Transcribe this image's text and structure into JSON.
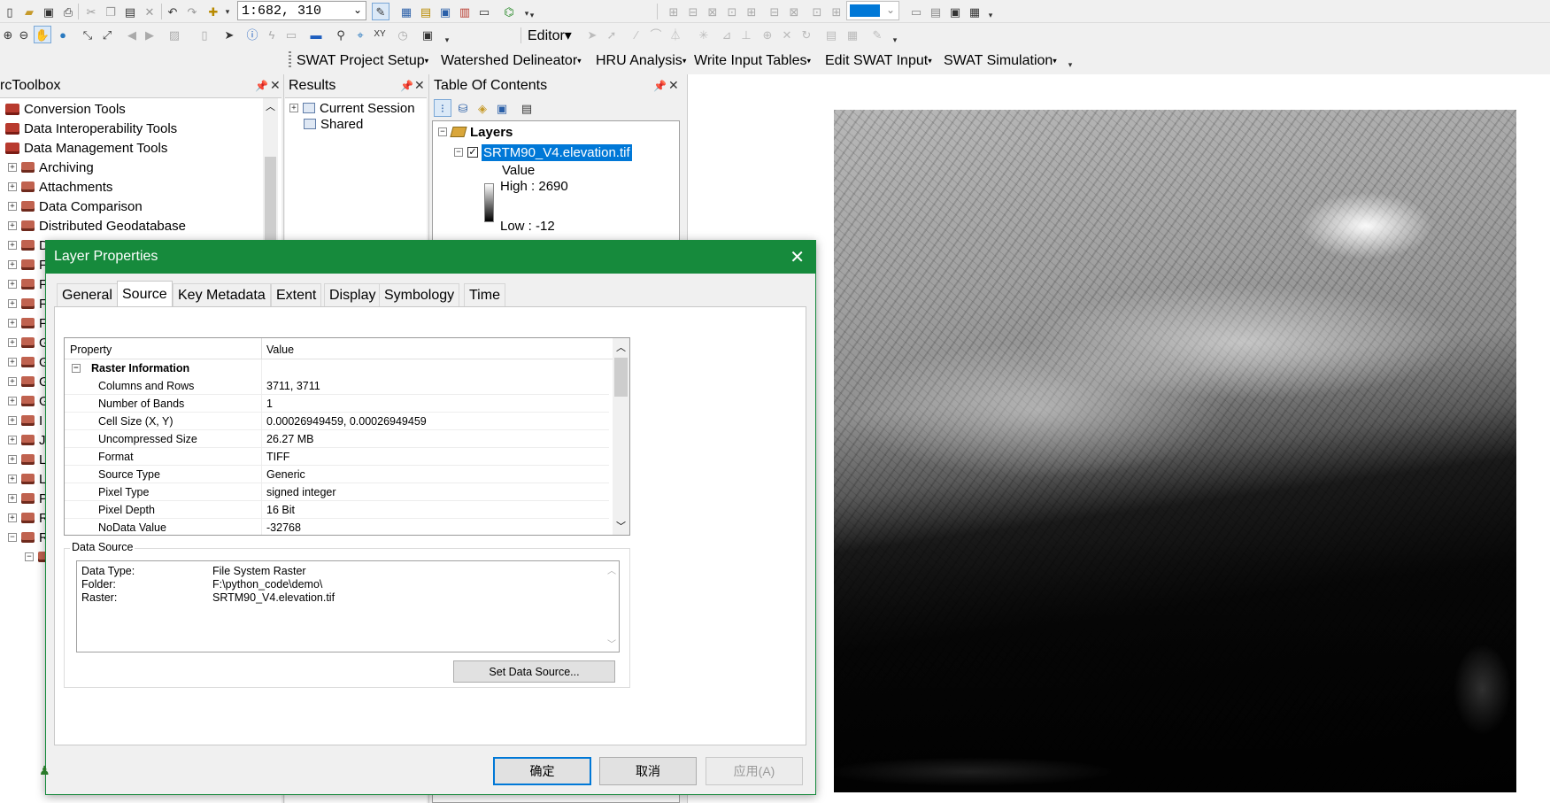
{
  "toolbar": {
    "scale_value": "1:682, 310",
    "editor_label": "Editor▾",
    "icons": [
      "new-icon",
      "open-icon",
      "save-icon",
      "print-icon",
      "cut-icon",
      "copy-icon",
      "paste-icon",
      "delete-icon",
      "undo-icon",
      "redo-icon",
      "add-data-icon",
      "zoom-in-icon",
      "zoom-out-icon",
      "pan-icon",
      "globe-icon",
      "fixed-zoom-in-icon",
      "fixed-zoom-out-icon",
      "back-icon",
      "forward-icon",
      "select-icon",
      "identify-icon",
      "find-icon",
      "measure-icon"
    ]
  },
  "swat_menu": {
    "items": [
      {
        "label": "SWAT Project Setup"
      },
      {
        "label": "Watershed Delineator"
      },
      {
        "label": "HRU Analysis"
      },
      {
        "label": "Write Input Tables"
      },
      {
        "label": "Edit SWAT Input"
      },
      {
        "label": "SWAT Simulation"
      }
    ]
  },
  "toolbox": {
    "title": "rcToolbox",
    "items": [
      {
        "label": "Conversion Tools"
      },
      {
        "label": "Data Interoperability Tools"
      },
      {
        "label": "Data Management Tools"
      },
      {
        "label": "Archiving"
      },
      {
        "label": "Attachments"
      },
      {
        "label": "Data Comparison"
      },
      {
        "label": "Distributed Geodatabase"
      },
      {
        "label": "D"
      },
      {
        "label": "F"
      },
      {
        "label": "F"
      },
      {
        "label": "F"
      },
      {
        "label": "F"
      },
      {
        "label": "G"
      },
      {
        "label": "G"
      },
      {
        "label": "G"
      },
      {
        "label": "G"
      },
      {
        "label": "I"
      },
      {
        "label": "J"
      },
      {
        "label": "L"
      },
      {
        "label": "L"
      },
      {
        "label": "P"
      },
      {
        "label": "R"
      },
      {
        "label": "R"
      }
    ]
  },
  "results": {
    "title": "Results",
    "items": [
      {
        "label": "Current Session"
      },
      {
        "label": "Shared"
      }
    ]
  },
  "toc": {
    "title": "Table Of Contents",
    "layers_label": "Layers",
    "layer_name": "SRTM90_V4.elevation.tif",
    "value_label": "Value",
    "high_label": "High : 2690",
    "low_label": "Low : -12"
  },
  "dialog": {
    "title": "Layer Properties",
    "tabs": [
      {
        "label": "General"
      },
      {
        "label": "Source"
      },
      {
        "label": "Key Metadata"
      },
      {
        "label": "Extent"
      },
      {
        "label": "Display"
      },
      {
        "label": "Symbology"
      },
      {
        "label": "Time"
      }
    ],
    "active_tab": "Source",
    "grid": {
      "col_property": "Property",
      "col_value": "Value",
      "section": "Raster Information",
      "rows": [
        {
          "key": "Columns and Rows",
          "value": "3711, 3711"
        },
        {
          "key": "Number of Bands",
          "value": "1"
        },
        {
          "key": "Cell Size (X, Y)",
          "value": "0.00026949459, 0.00026949459"
        },
        {
          "key": "Uncompressed Size",
          "value": "26.27 MB"
        },
        {
          "key": "Format",
          "value": "TIFF"
        },
        {
          "key": "Source Type",
          "value": "Generic"
        },
        {
          "key": "Pixel Type",
          "value": "signed integer"
        },
        {
          "key": "Pixel Depth",
          "value": "16 Bit"
        },
        {
          "key": "NoData Value",
          "value": "-32768"
        }
      ]
    },
    "data_source": {
      "legend": "Data Source",
      "rows": [
        {
          "key": "Data Type:",
          "value": "File System Raster"
        },
        {
          "key": "Folder:",
          "value": "F:\\python_code\\demo\\"
        },
        {
          "key": "Raster:",
          "value": "SRTM90_V4.elevation.tif"
        }
      ],
      "set_button": "Set Data Source..."
    },
    "buttons": {
      "ok": "确定",
      "cancel": "取消",
      "apply": "应用(A)"
    }
  },
  "colors": {
    "dialog_accent": "#168a3c",
    "selection": "#0078d7"
  }
}
